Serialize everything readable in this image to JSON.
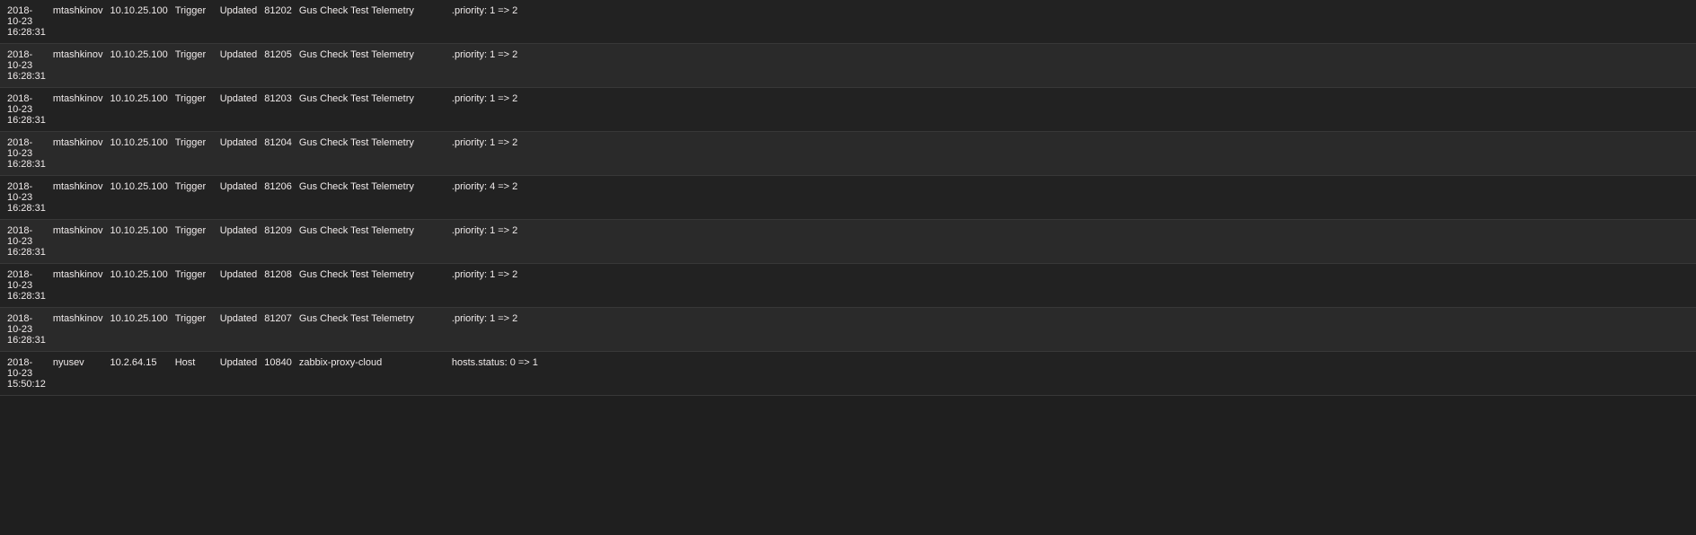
{
  "rows": [
    {
      "time": "2018-10-23 16:28:31",
      "user": "mtashkinov",
      "ip": "10.10.25.100",
      "type": "Trigger",
      "action": "Updated",
      "id": "81202",
      "description": "Gus Check Test Telemetry",
      "details": ".priority: 1 => 2"
    },
    {
      "time": "2018-10-23 16:28:31",
      "user": "mtashkinov",
      "ip": "10.10.25.100",
      "type": "Trigger",
      "action": "Updated",
      "id": "81205",
      "description": "Gus Check Test Telemetry",
      "details": ".priority: 1 => 2"
    },
    {
      "time": "2018-10-23 16:28:31",
      "user": "mtashkinov",
      "ip": "10.10.25.100",
      "type": "Trigger",
      "action": "Updated",
      "id": "81203",
      "description": "Gus Check Test Telemetry",
      "details": ".priority: 1 => 2"
    },
    {
      "time": "2018-10-23 16:28:31",
      "user": "mtashkinov",
      "ip": "10.10.25.100",
      "type": "Trigger",
      "action": "Updated",
      "id": "81204",
      "description": "Gus Check Test Telemetry",
      "details": ".priority: 1 => 2"
    },
    {
      "time": "2018-10-23 16:28:31",
      "user": "mtashkinov",
      "ip": "10.10.25.100",
      "type": "Trigger",
      "action": "Updated",
      "id": "81206",
      "description": "Gus Check Test Telemetry",
      "details": ".priority: 4 => 2"
    },
    {
      "time": "2018-10-23 16:28:31",
      "user": "mtashkinov",
      "ip": "10.10.25.100",
      "type": "Trigger",
      "action": "Updated",
      "id": "81209",
      "description": "Gus Check Test Telemetry",
      "details": ".priority: 1 => 2"
    },
    {
      "time": "2018-10-23 16:28:31",
      "user": "mtashkinov",
      "ip": "10.10.25.100",
      "type": "Trigger",
      "action": "Updated",
      "id": "81208",
      "description": "Gus Check Test Telemetry",
      "details": ".priority: 1 => 2"
    },
    {
      "time": "2018-10-23 16:28:31",
      "user": "mtashkinov",
      "ip": "10.10.25.100",
      "type": "Trigger",
      "action": "Updated",
      "id": "81207",
      "description": "Gus Check Test Telemetry",
      "details": ".priority: 1 => 2"
    },
    {
      "time": "2018-10-23 15:50:12",
      "user": "nyusev",
      "ip": "10.2.64.15",
      "type": "Host",
      "action": "Updated",
      "id": "10840",
      "description": "zabbix-proxy-cloud",
      "details": "hosts.status: 0 => 1"
    }
  ]
}
